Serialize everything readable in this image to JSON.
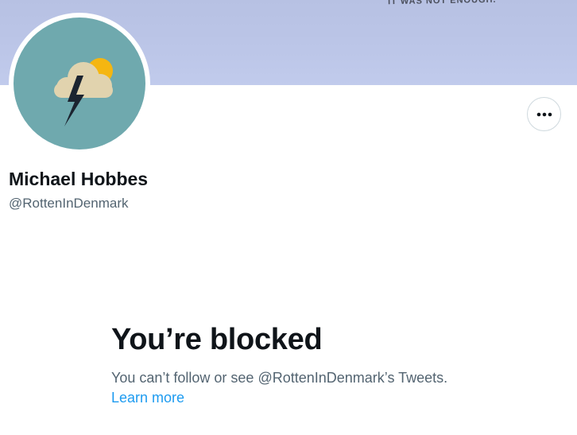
{
  "banner": {
    "text": "IT WAS NOT ENOUGH.",
    "color": "#bcc6e8"
  },
  "avatar": {
    "icon": "storm-cloud-icon",
    "background_color": "#6fa9ae"
  },
  "header": {
    "more_icon": "more-horizontal-icon"
  },
  "profile": {
    "name": "Michael Hobbes",
    "handle": "@RottenInDenmark"
  },
  "blocked": {
    "title": "You’re blocked",
    "message": "You can’t follow or see @RottenInDenmark’s Tweets.",
    "learn_more": "Learn more"
  },
  "colors": {
    "text_primary": "#0f1419",
    "text_secondary": "#536471",
    "link": "#1d9bf0"
  }
}
